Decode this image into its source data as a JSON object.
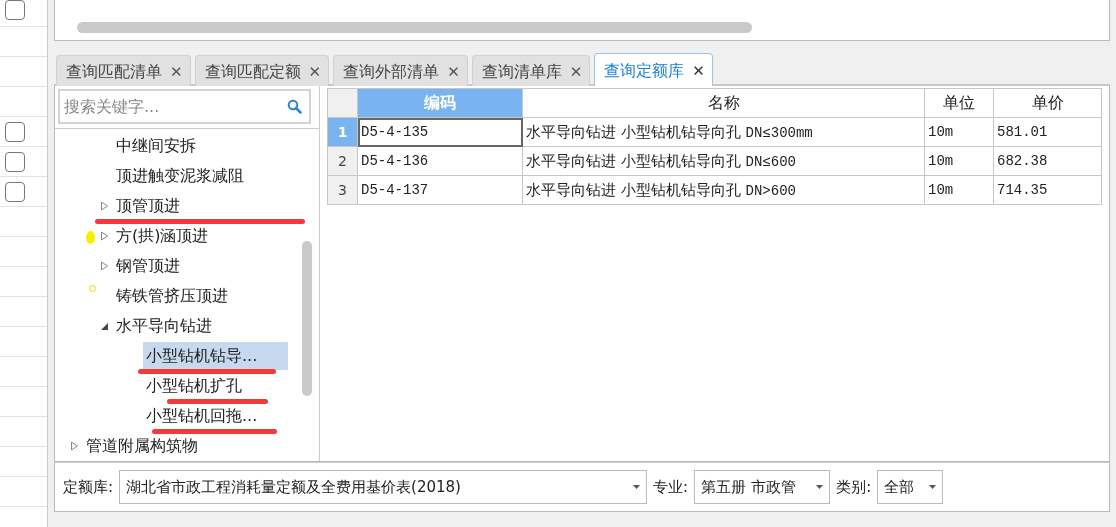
{
  "left_checkboxes": [
    {
      "checked": false
    },
    {
      "checked": false
    },
    {
      "checked": false
    },
    {
      "checked": false
    }
  ],
  "tabs": [
    {
      "label": "查询匹配清单",
      "selected": false,
      "close": "✕"
    },
    {
      "label": "查询匹配定额",
      "selected": false,
      "close": "✕"
    },
    {
      "label": "查询外部清单",
      "selected": false,
      "close": "✕"
    },
    {
      "label": "查询清单库",
      "selected": false,
      "close": "✕"
    },
    {
      "label": "查询定额库",
      "selected": true,
      "close": "✕"
    }
  ],
  "search": {
    "placeholder": "搜索关键字..."
  },
  "tree_items": [
    {
      "label": "中继间安拆",
      "expandable": false,
      "expanded": false,
      "selected": false
    },
    {
      "label": "顶进触变泥浆减阻",
      "expandable": false,
      "expanded": false,
      "selected": false
    },
    {
      "label": "顶管顶进",
      "expandable": true,
      "expanded": false,
      "selected": false
    },
    {
      "label": "方(拱)涵顶进",
      "expandable": true,
      "expanded": false,
      "selected": false
    },
    {
      "label": "钢管顶进",
      "expandable": true,
      "expanded": false,
      "selected": false
    },
    {
      "label": "铸铁管挤压顶进",
      "expandable": false,
      "expanded": false,
      "selected": false
    },
    {
      "label": "水平导向钻进",
      "expandable": true,
      "expanded": true,
      "selected": false,
      "children": [
        {
          "label": "小型钻机钻导...",
          "expandable": false,
          "expanded": false,
          "selected": true
        },
        {
          "label": "小型钻机扩孔",
          "expandable": false,
          "expanded": false,
          "selected": false
        },
        {
          "label": "小型钻机回拖...",
          "expandable": false,
          "expanded": false,
          "selected": false
        }
      ]
    }
  ],
  "tree_next_items": [
    {
      "label": "管道附属构筑物",
      "expandable": true,
      "expanded": false,
      "selected": false
    }
  ],
  "table": {
    "columns": [
      {
        "label": "编码",
        "selected": true
      },
      {
        "label": "名称",
        "selected": false
      },
      {
        "label": "单位",
        "selected": false
      },
      {
        "label": "单价",
        "selected": false
      }
    ],
    "rows": [
      {
        "index": "1",
        "selected": true,
        "cells": [
          "D5-4-135",
          "水平导向钻进 小型钻机钻导向孔 DN≤300mm",
          "10m",
          "581.01"
        ]
      },
      {
        "index": "2",
        "selected": false,
        "cells": [
          "D5-4-136",
          "水平导向钻进 小型钻机钻导向孔 DN≤600",
          "10m",
          "682.38"
        ]
      },
      {
        "index": "3",
        "selected": false,
        "cells": [
          "D5-4-137",
          "水平导向钻进 小型钻机钻导向孔 DN>600",
          "10m",
          "714.35"
        ]
      }
    ]
  },
  "filters": [
    {
      "label": "定额库:",
      "value": "湖北省市政工程消耗量定额及全费用基价表(2018)"
    },
    {
      "label": "专业:",
      "value": "第五册 市政管"
    },
    {
      "label": "类别:",
      "value": "全部"
    }
  ]
}
